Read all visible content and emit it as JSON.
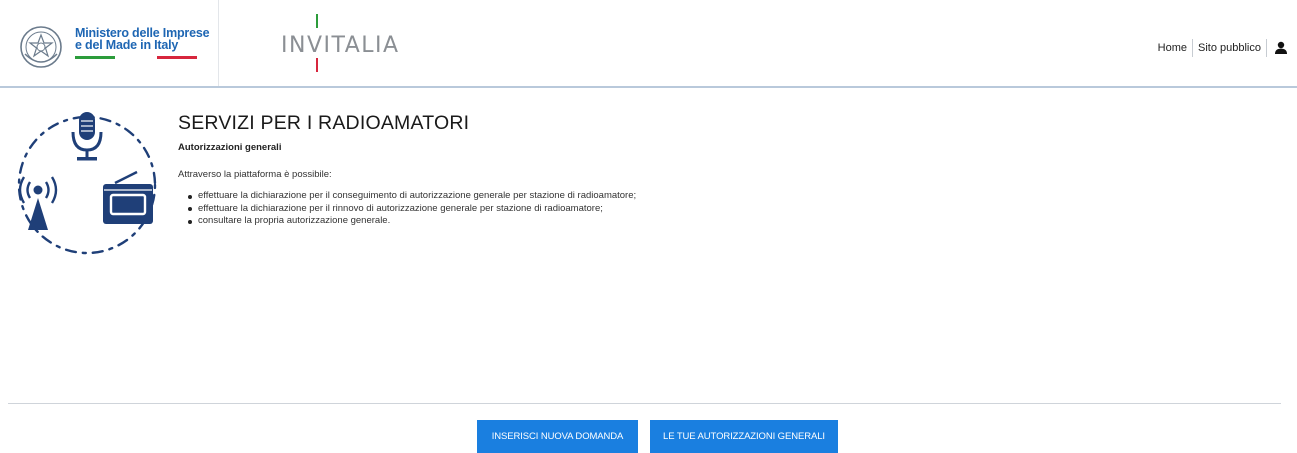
{
  "header": {
    "ministry_line1": "Ministero delle Imprese",
    "ministry_line2": "e del Made in Italy",
    "brand": "INVITALIA",
    "nav": [
      {
        "label": "Home"
      },
      {
        "label": "Sito pubblico"
      }
    ],
    "user_icon": "user-icon"
  },
  "main": {
    "title": "SERVIZI PER I RADIOAMATORI",
    "subtitle": "Autorizzazioni generali",
    "intro": "Attraverso la piattaforma è possibile:",
    "bullets": [
      "effettuare la dichiarazione per il conseguimento di autorizzazione generale per stazione di radioamatore;",
      "effettuare la dichiarazione per il rinnovo di autorizzazione generale per stazione di radioamatore;",
      "consultare la propria autorizzazione generale."
    ],
    "illustration_icons": [
      "microphone-icon",
      "antenna-icon",
      "radio-icon"
    ]
  },
  "actions": {
    "new_request": "INSERISCI NUOVA DOMANDA",
    "my_authorizations": "LE TUE AUTORIZZAZIONI GENERALI"
  },
  "colors": {
    "accent": "#1a7fe0",
    "ministry_blue": "#1e66b3",
    "icon_navy": "#1f3f78",
    "flag_green": "#2c9c3b",
    "flag_red": "#d7263d"
  }
}
